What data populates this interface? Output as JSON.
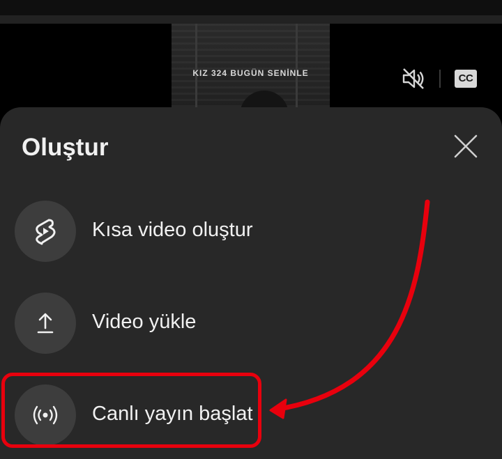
{
  "video": {
    "thumbnail_title": "KIZ 324 BUGÜN SENİNLE",
    "mute_icon": "volume-off-icon",
    "cc_label": "CC"
  },
  "sheet": {
    "title": "Oluştur",
    "close_icon": "close-icon",
    "options": [
      {
        "label": "Kısa video oluştur",
        "icon": "shorts-icon"
      },
      {
        "label": "Video yükle",
        "icon": "upload-icon"
      },
      {
        "label": "Canlı yayın başlat",
        "icon": "live-broadcast-icon"
      }
    ]
  },
  "annotation": {
    "color": "#e8000d",
    "highlighted_option": "Canlı yayın başlat"
  },
  "colors": {
    "sheet_background": "#282828",
    "icon_circle": "#3d3d3d",
    "text": "#f1f1f1"
  }
}
